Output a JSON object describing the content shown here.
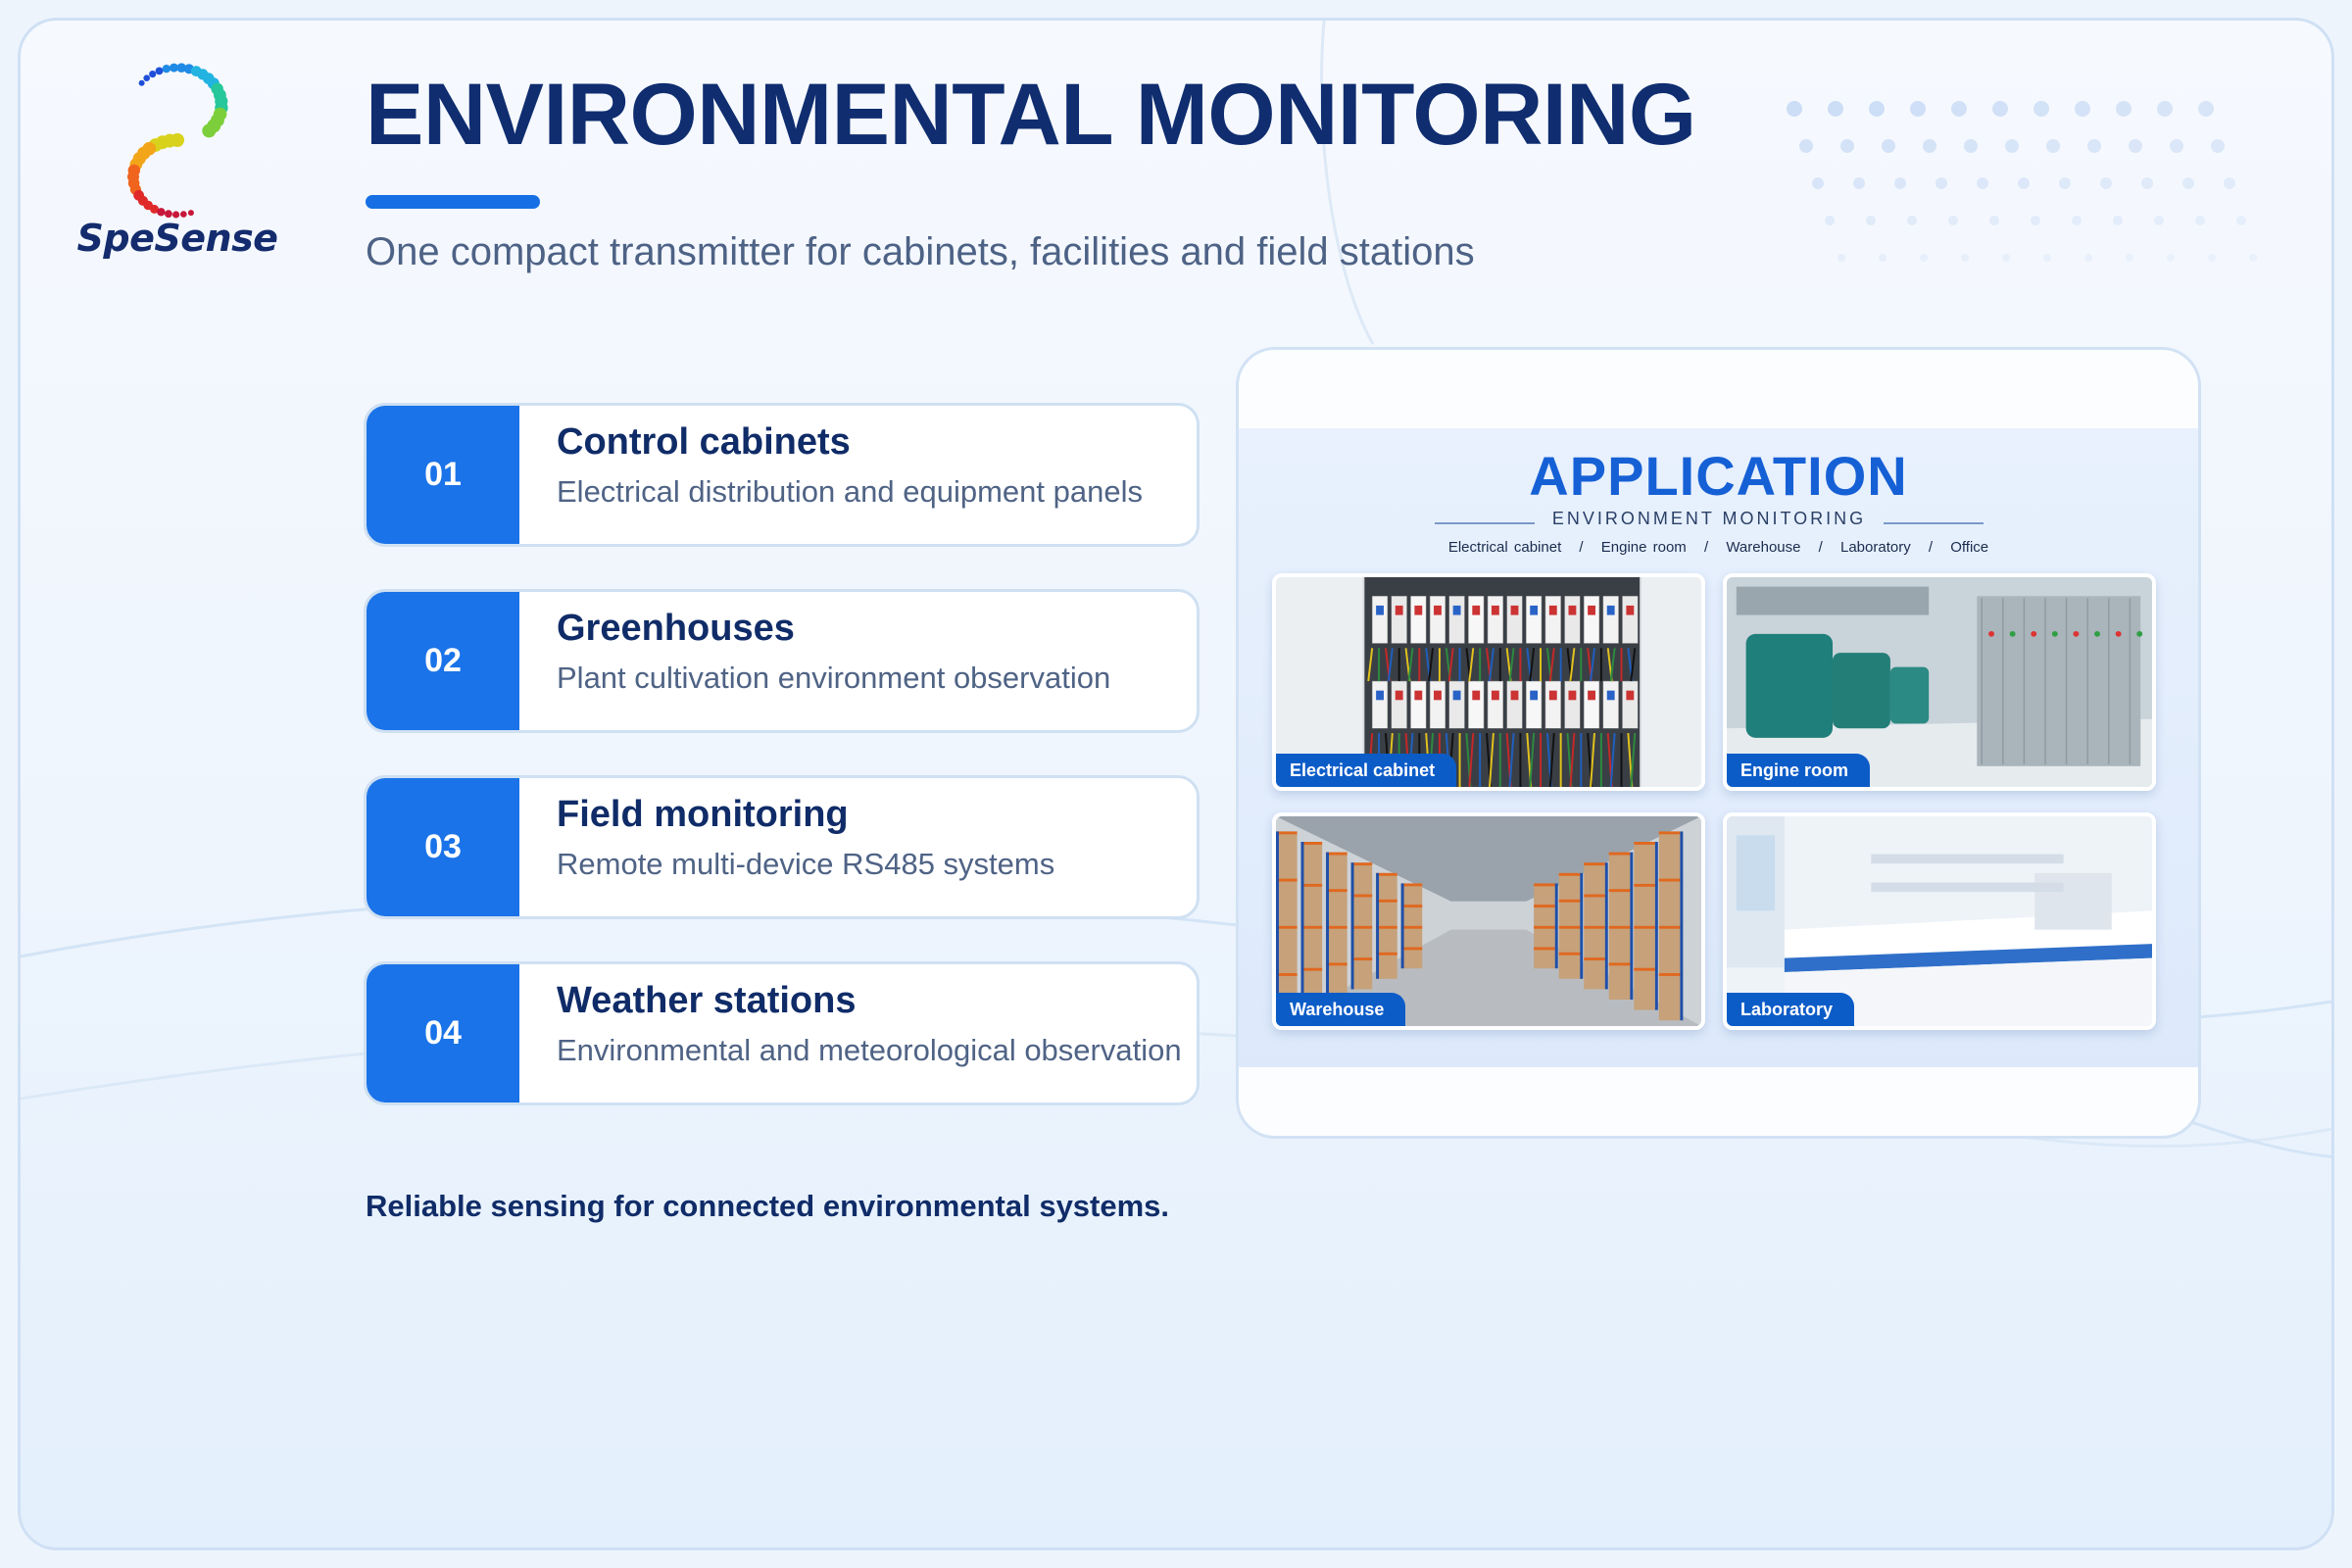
{
  "brand": {
    "name": "SpeSense"
  },
  "header": {
    "title": "ENVIRONMENTAL MONITORING",
    "subtitle": "One compact transmitter for cabinets, facilities and field stations"
  },
  "items": [
    {
      "number": "01",
      "title": "Control cabinets",
      "description": "Electrical distribution and equipment panels"
    },
    {
      "number": "02",
      "title": "Greenhouses",
      "description": "Plant cultivation environment observation"
    },
    {
      "number": "03",
      "title": "Field monitoring",
      "description": "Remote multi-device RS485 systems"
    },
    {
      "number": "04",
      "title": "Weather stations",
      "description": "Environmental and meteorological observation"
    }
  ],
  "footer_note": "Reliable sensing for connected environmental systems.",
  "application": {
    "title": "APPLICATION",
    "subtitle": "ENVIRONMENT  MONITORING",
    "categories": [
      "Electrical cabinet",
      "Engine room",
      "Warehouse",
      "Laboratory",
      "Office"
    ],
    "separator": "/",
    "tiles": [
      {
        "label": "Electrical cabinet"
      },
      {
        "label": "Engine room"
      },
      {
        "label": "Warehouse"
      },
      {
        "label": "Laboratory"
      }
    ]
  },
  "colors": {
    "primary": "#1a73e8",
    "title": "#0f2d6f",
    "text_muted": "#4f6385",
    "accent_blue": "#1660d6"
  }
}
